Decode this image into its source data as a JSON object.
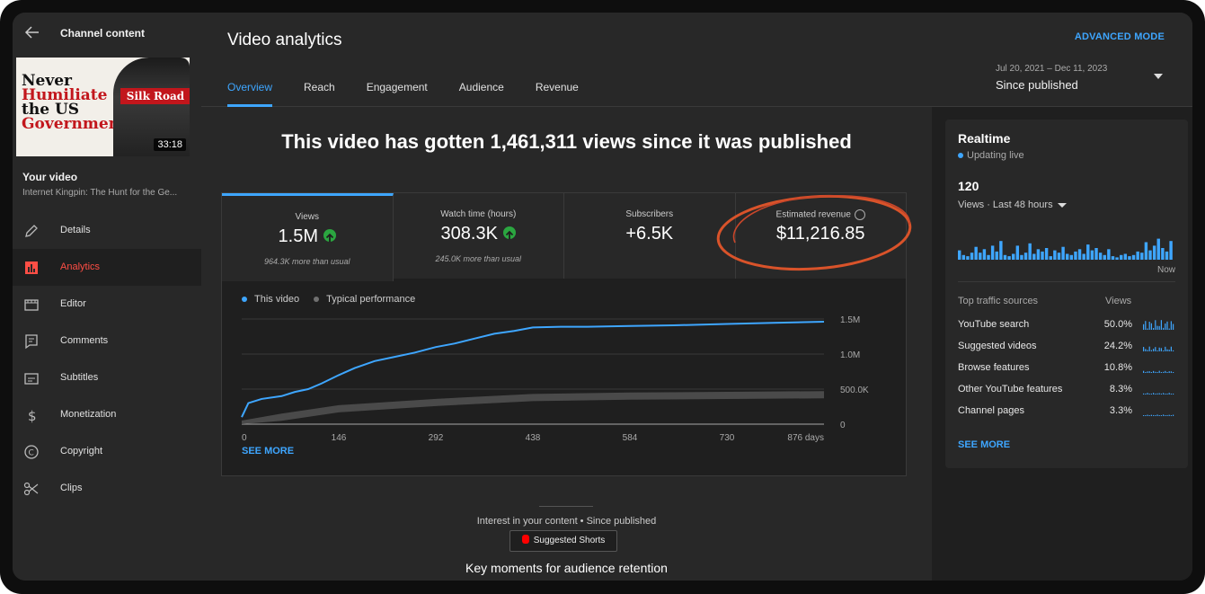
{
  "sidebar": {
    "title": "Channel content",
    "thumbnail": {
      "line1": "Never",
      "line2": "Humiliate",
      "line3": "the US",
      "line4": "Government",
      "banner": "Silk Road",
      "duration": "33:18"
    },
    "your_video_label": "Your video",
    "video_title": "Internet Kingpin: The Hunt for the Ge...",
    "nav": [
      {
        "label": "Details",
        "icon": "pencil-icon"
      },
      {
        "label": "Analytics",
        "icon": "analytics-icon",
        "active": true
      },
      {
        "label": "Editor",
        "icon": "editor-icon"
      },
      {
        "label": "Comments",
        "icon": "comments-icon"
      },
      {
        "label": "Subtitles",
        "icon": "subtitles-icon"
      },
      {
        "label": "Monetization",
        "icon": "dollar-icon"
      },
      {
        "label": "Copyright",
        "icon": "copyright-icon"
      },
      {
        "label": "Clips",
        "icon": "scissors-icon"
      }
    ]
  },
  "header": {
    "title": "Video analytics",
    "advanced_mode": "ADVANCED MODE",
    "tabs": [
      "Overview",
      "Reach",
      "Engagement",
      "Audience",
      "Revenue"
    ],
    "active_tab": "Overview",
    "date_range": "Jul 20, 2021 – Dec 11, 2023",
    "date_selection": "Since published"
  },
  "overview": {
    "headline": "This video has gotten 1,461,311 views since it was published",
    "metrics": [
      {
        "label": "Views",
        "value": "1.5M",
        "sub": "964.3K more than usual",
        "trend": "up"
      },
      {
        "label": "Watch time (hours)",
        "value": "308.3K",
        "sub": "245.0K more than usual",
        "trend": "up"
      },
      {
        "label": "Subscribers",
        "value": "+6.5K",
        "sub": ""
      },
      {
        "label": "Estimated revenue",
        "value": "$11,216.85",
        "sub": ""
      }
    ],
    "see_more": "SEE MORE",
    "interest_text": "Interest in your content • Since published",
    "shorts_button": "Suggested Shorts",
    "key_moments": "Key moments for audience retention"
  },
  "chart_data": {
    "type": "line",
    "series": [
      {
        "name": "This video",
        "color": "#3ea6ff",
        "x": [
          0,
          10,
          30,
          60,
          80,
          100,
          120,
          146,
          170,
          200,
          230,
          260,
          292,
          320,
          350,
          380,
          410,
          438,
          480,
          520,
          584,
          650,
          730,
          800,
          876
        ],
        "y": [
          100000,
          300000,
          360000,
          400000,
          460000,
          500000,
          580000,
          700000,
          800000,
          900000,
          960000,
          1020000,
          1100000,
          1150000,
          1220000,
          1290000,
          1330000,
          1380000,
          1390000,
          1390000,
          1400000,
          1410000,
          1430000,
          1445000,
          1461311
        ]
      },
      {
        "name": "Typical performance",
        "color": "#606060",
        "x": [
          0,
          60,
          146,
          292,
          438,
          584,
          730,
          876
        ],
        "y": [
          0,
          100000,
          220000,
          310000,
          380000,
          400000,
          410000,
          420000
        ]
      }
    ],
    "x_ticks": [
      "0",
      "146",
      "292",
      "438",
      "584",
      "730",
      "876 days"
    ],
    "y_ticks": [
      "0",
      "500.0K",
      "1.0M",
      "1.5M"
    ],
    "ylim": [
      0,
      1500000
    ],
    "xlim": [
      0,
      876
    ]
  },
  "realtime": {
    "title": "Realtime",
    "status": "Updating live",
    "count": "120",
    "period": "Views · Last 48 hours",
    "now_label": "Now",
    "bars": [
      0.4,
      0.2,
      0.15,
      0.3,
      0.55,
      0.3,
      0.45,
      0.2,
      0.6,
      0.35,
      0.8,
      0.2,
      0.15,
      0.25,
      0.6,
      0.2,
      0.3,
      0.7,
      0.25,
      0.45,
      0.35,
      0.5,
      0.15,
      0.4,
      0.3,
      0.55,
      0.25,
      0.2,
      0.35,
      0.45,
      0.25,
      0.65,
      0.4,
      0.5,
      0.3,
      0.2,
      0.45,
      0.15,
      0.1,
      0.2,
      0.25,
      0.15,
      0.2,
      0.35,
      0.3,
      0.75,
      0.4,
      0.6,
      0.9,
      0.5,
      0.35,
      0.8
    ],
    "traffic_header": "Top traffic sources",
    "views_header": "Views",
    "sources": [
      {
        "name": "YouTube search",
        "value": "50.0%"
      },
      {
        "name": "Suggested videos",
        "value": "24.2%"
      },
      {
        "name": "Browse features",
        "value": "10.8%"
      },
      {
        "name": "Other YouTube features",
        "value": "8.3%"
      },
      {
        "name": "Channel pages",
        "value": "3.3%"
      }
    ],
    "see_more": "SEE MORE"
  },
  "colors": {
    "accent": "#3ea6ff",
    "active_nav": "#ff4e45",
    "trend_up": "#2ba640",
    "annotation": "#e05a2b"
  }
}
